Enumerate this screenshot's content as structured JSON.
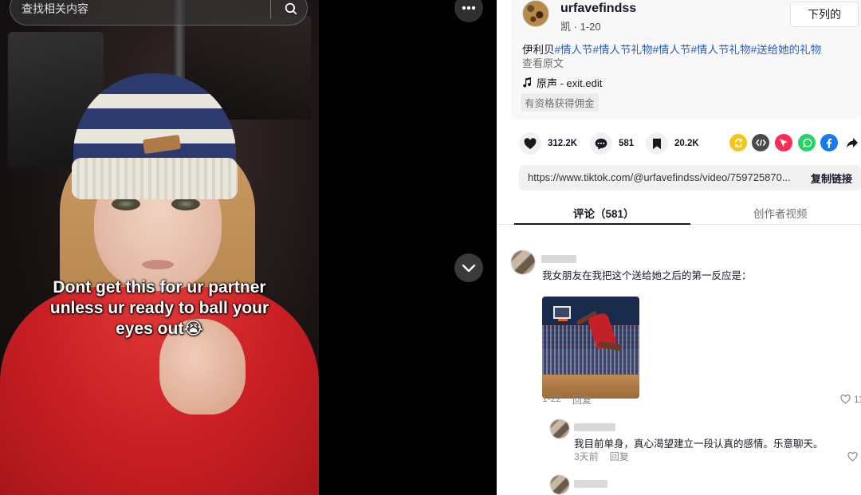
{
  "search": {
    "placeholder": "查找相关内容"
  },
  "video": {
    "caption_lines": [
      "Dont get this for ur partner",
      "unless ur ready to ball your",
      "eyes out😭"
    ]
  },
  "author": {
    "username": "urfavefindss",
    "display_name": "凯",
    "date": "1-20",
    "follow_label": "下列的"
  },
  "description": {
    "prefix": "伊利贝",
    "tags": [
      "#情人节",
      "#情人节礼物",
      "#情人节",
      "#情人节礼物",
      "#送给她的礼物"
    ],
    "translate_label": "查看原文"
  },
  "music": {
    "label": "原声 - exit.edit"
  },
  "commission": {
    "label": "有资格获得佣金"
  },
  "stats": {
    "likes": "312.2K",
    "comments": "581",
    "saves": "20.2K"
  },
  "share_icons": [
    "repost-icon",
    "embed-icon",
    "send-icon",
    "whatsapp-icon",
    "facebook-icon",
    "share-arrow-icon"
  ],
  "colors": {
    "repost": "#f5c518",
    "embed": "#4a4a4a",
    "send": "#fe2c55",
    "whatsapp": "#25d366",
    "facebook": "#1877f2",
    "tag_link": "#2b5db9"
  },
  "link": {
    "url": "https://www.tiktok.com/@urfavefindss/video/759725870...",
    "copy_label": "复制链接"
  },
  "tabs": {
    "comments_label": "评论（581）",
    "creator_videos_label": "创作者视频"
  },
  "comments": [
    {
      "text": "我女朋友在我把这个送给她之后的第一反应是：",
      "date": "1-22",
      "reply_label": "回复",
      "likes": "11"
    },
    {
      "text": "我目前单身，真心渴望建立一段认真的感情。乐意聊天。",
      "date": "3天前",
      "reply_label": "回复",
      "likes": ""
    }
  ]
}
